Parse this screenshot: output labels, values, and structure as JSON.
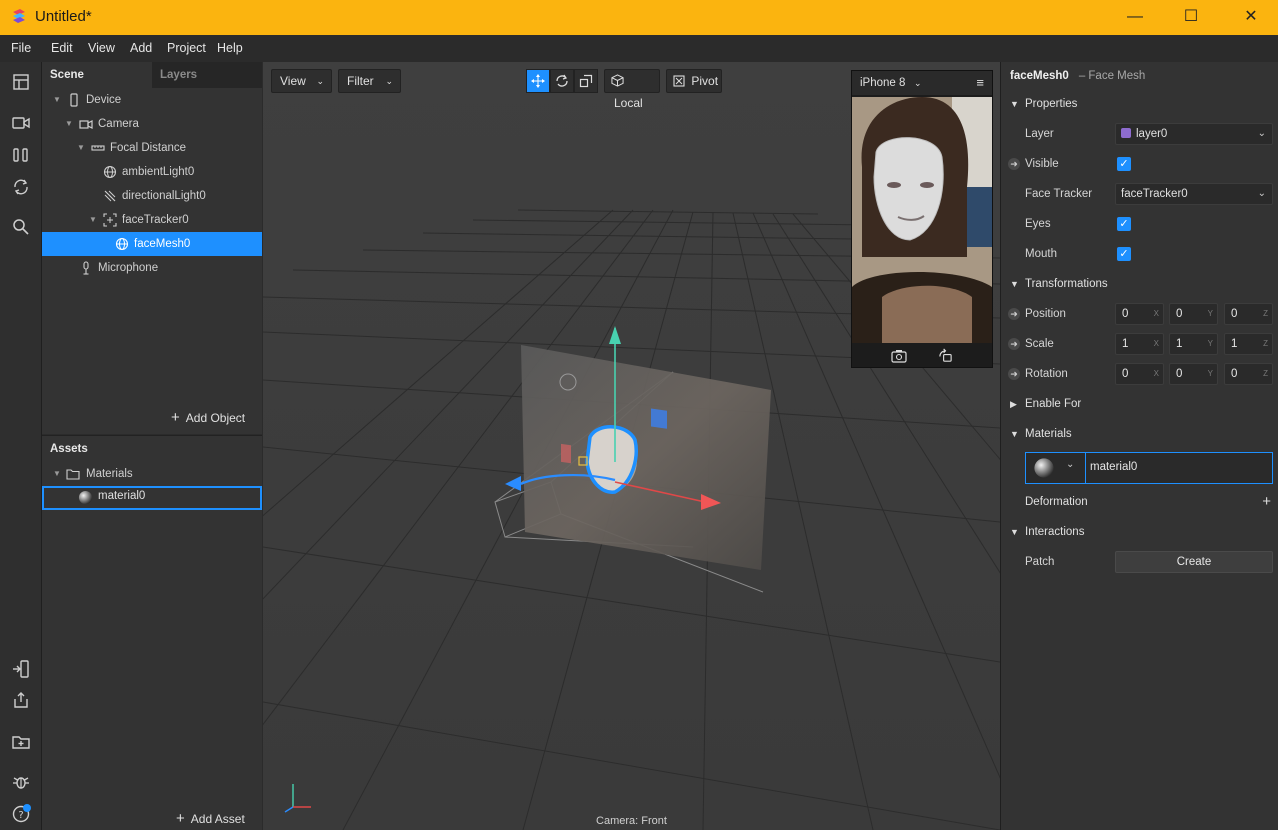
{
  "window": {
    "title": "Untitled*",
    "minimize": "—",
    "maximize": "☐",
    "close": "✕"
  },
  "menu": [
    "File",
    "Edit",
    "View",
    "Add",
    "Project",
    "Help"
  ],
  "left_toolbar": [
    "layout-icon",
    "video-icon",
    "patch-icon",
    "sync-icon",
    "search-icon",
    "device-send-icon",
    "export-icon",
    "folder-add-icon",
    "bug-icon",
    "help-icon"
  ],
  "scene": {
    "tabs": [
      "Scene",
      "Layers"
    ],
    "tree": [
      {
        "label": "Device",
        "icon": "phone-icon"
      },
      {
        "label": "Camera",
        "icon": "camera-icon"
      },
      {
        "label": "Focal Distance",
        "icon": "focal-icon"
      },
      {
        "label": "ambientLight0",
        "icon": "globe-icon"
      },
      {
        "label": "directionalLight0",
        "icon": "light-icon"
      },
      {
        "label": "faceTracker0",
        "icon": "facetracker-icon"
      },
      {
        "label": "faceMesh0",
        "icon": "mesh-icon"
      },
      {
        "label": "Microphone",
        "icon": "microphone-icon"
      }
    ],
    "add_object": "Add Object"
  },
  "assets": {
    "title": "Assets",
    "folder": "Materials",
    "item": "material0",
    "add_asset": "Add Asset"
  },
  "viewport": {
    "view_label": "View",
    "filter_label": "Filter",
    "local_label": "Local",
    "pivot_label": "Pivot",
    "camera_label": "Camera: Front",
    "device": "iPhone 8"
  },
  "inspector": {
    "object_name": "faceMesh0",
    "object_type": "– Face Mesh",
    "sections": {
      "properties": "Properties",
      "transformations": "Transformations",
      "enable_for": "Enable For",
      "materials": "Materials",
      "deformation": "Deformation",
      "interactions": "Interactions"
    },
    "layer": {
      "label": "Layer",
      "value": "layer0",
      "color": "#8e6ccf"
    },
    "visible": {
      "label": "Visible",
      "checked": true
    },
    "face_tracker": {
      "label": "Face Tracker",
      "value": "faceTracker0"
    },
    "eyes": {
      "label": "Eyes",
      "checked": true
    },
    "mouth": {
      "label": "Mouth",
      "checked": true
    },
    "position": {
      "label": "Position",
      "x": "0",
      "y": "0",
      "z": "0"
    },
    "scale": {
      "label": "Scale",
      "x": "1",
      "y": "1",
      "z": "1"
    },
    "rotation": {
      "label": "Rotation",
      "x": "0",
      "y": "0",
      "z": "0"
    },
    "material": "material0",
    "patch": {
      "label": "Patch",
      "button": "Create"
    },
    "axis_labels": [
      "X",
      "Y",
      "Z"
    ]
  },
  "colors": {
    "accent": "#1e90ff",
    "titlebar": "#fbb40f"
  }
}
